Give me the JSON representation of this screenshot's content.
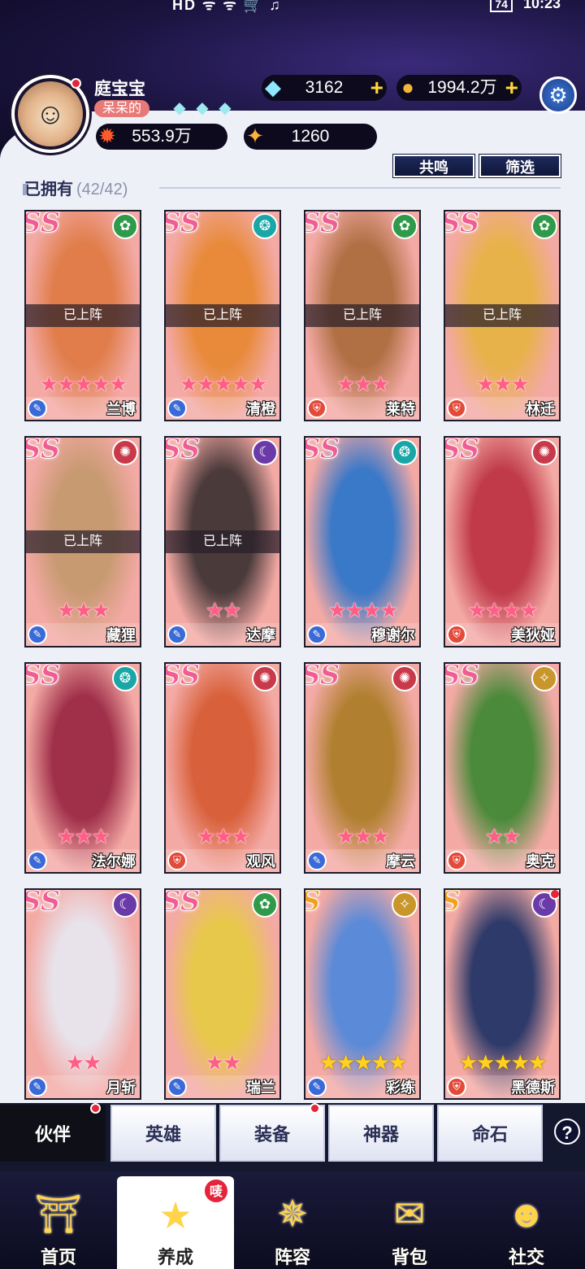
{
  "status_bar": {
    "left": "HD ᯤ ᯤ 🛒 ♫",
    "battery": "74",
    "time": "10:23"
  },
  "player": {
    "name": "庭宝宝",
    "title": "呆呆的",
    "avatar_icon": "face-avatar-icon",
    "power": "553.9万",
    "points": "1260"
  },
  "currency": {
    "diamonds": "3162",
    "gold": "1994.2万"
  },
  "buttons": {
    "resonance": "共鸣",
    "filter": "筛选"
  },
  "section": {
    "label": "已拥有",
    "count": "(42/42)"
  },
  "deployed_label": "已上阵",
  "heroes": [
    {
      "rank": "SS",
      "name": "兰博",
      "stars": 5,
      "star_color": "pink",
      "element": "green",
      "type": "blue",
      "deployed": true,
      "art": "#e07d4a"
    },
    {
      "rank": "SS",
      "name": "清橙",
      "stars": 5,
      "star_color": "pink",
      "element": "teal",
      "type": "blue",
      "deployed": true,
      "art": "#e88a3a"
    },
    {
      "rank": "SS",
      "name": "莱特",
      "stars": 3,
      "star_color": "pink",
      "element": "green",
      "type": "red",
      "deployed": true,
      "art": "#b07044"
    },
    {
      "rank": "SS",
      "name": "林迁",
      "stars": 3,
      "star_color": "pink",
      "element": "green",
      "type": "red",
      "deployed": true,
      "art": "#e8b24a"
    },
    {
      "rank": "SS",
      "name": "藏狸",
      "stars": 3,
      "star_color": "pink",
      "element": "red",
      "type": "blue",
      "deployed": true,
      "art": "#c89a72"
    },
    {
      "rank": "SS",
      "name": "达摩",
      "stars": 2,
      "star_color": "pink",
      "element": "purple",
      "type": "blue",
      "deployed": true,
      "art": "#4a3a3a"
    },
    {
      "rank": "SS",
      "name": "穆谢尔",
      "stars": 4,
      "star_color": "pink",
      "element": "teal",
      "type": "blue",
      "deployed": false,
      "art": "#3a78c8"
    },
    {
      "rank": "SS",
      "name": "美狄娅",
      "stars": 4,
      "star_color": "pink",
      "element": "red",
      "type": "red",
      "deployed": false,
      "art": "#c03a4a"
    },
    {
      "rank": "SS",
      "name": "法尔娜",
      "stars": 3,
      "star_color": "pink",
      "element": "teal",
      "type": "blue",
      "deployed": false,
      "art": "#a0304a"
    },
    {
      "rank": "SS",
      "name": "观风",
      "stars": 3,
      "star_color": "pink",
      "element": "red",
      "type": "red",
      "deployed": false,
      "art": "#d8603a"
    },
    {
      "rank": "SS",
      "name": "摩云",
      "stars": 3,
      "star_color": "pink",
      "element": "red",
      "type": "blue",
      "deployed": false,
      "art": "#b08030"
    },
    {
      "rank": "SS",
      "name": "奥克",
      "stars": 2,
      "star_color": "pink",
      "element": "gold",
      "type": "red",
      "deployed": false,
      "art": "#4a8a3a"
    },
    {
      "rank": "SS",
      "name": "月斩",
      "stars": 2,
      "star_color": "pink",
      "element": "purple",
      "type": "blue",
      "deployed": false,
      "art": "#e8e2ea"
    },
    {
      "rank": "SS",
      "name": "瑞兰",
      "stars": 2,
      "star_color": "pink",
      "element": "green",
      "type": "blue",
      "deployed": false,
      "art": "#e8c84a"
    },
    {
      "rank": "S",
      "name": "彩练",
      "stars": 5,
      "star_color": "gold",
      "element": "gold",
      "type": "blue",
      "deployed": false,
      "art": "#5a8ad8"
    },
    {
      "rank": "S",
      "name": "黑德斯",
      "stars": 5,
      "star_color": "gold",
      "element": "purple",
      "type": "red",
      "deployed": false,
      "art": "#2e3a6a",
      "reddot": true
    }
  ],
  "sub_tabs": [
    {
      "label": "伙伴",
      "active": true,
      "dot": true
    },
    {
      "label": "英雄",
      "active": false,
      "dot": false
    },
    {
      "label": "装备",
      "active": false,
      "dot": true
    },
    {
      "label": "神器",
      "active": false,
      "dot": false
    },
    {
      "label": "命石",
      "active": false,
      "dot": false
    }
  ],
  "help_label": "?",
  "main_nav": [
    {
      "label": "首页",
      "icon": "home-gate-icon",
      "active": false
    },
    {
      "label": "养成",
      "icon": "star-cultivate-icon",
      "active": true,
      "badge": "唛"
    },
    {
      "label": "阵容",
      "icon": "formation-icon",
      "active": false
    },
    {
      "label": "背包",
      "icon": "backpack-icon",
      "active": false
    },
    {
      "label": "社交",
      "icon": "social-icon",
      "active": false
    }
  ],
  "colors": {
    "rank_ss": "#f05d93",
    "rank_s": "#f0a21c",
    "element_green": "#2e9a4a",
    "element_teal": "#1aa6a6",
    "element_red": "#c83a4a",
    "element_purple": "#6a3aa8",
    "element_gold": "#c8962a",
    "type_blue": "#3a6ad8",
    "type_red": "#e24a3a"
  }
}
